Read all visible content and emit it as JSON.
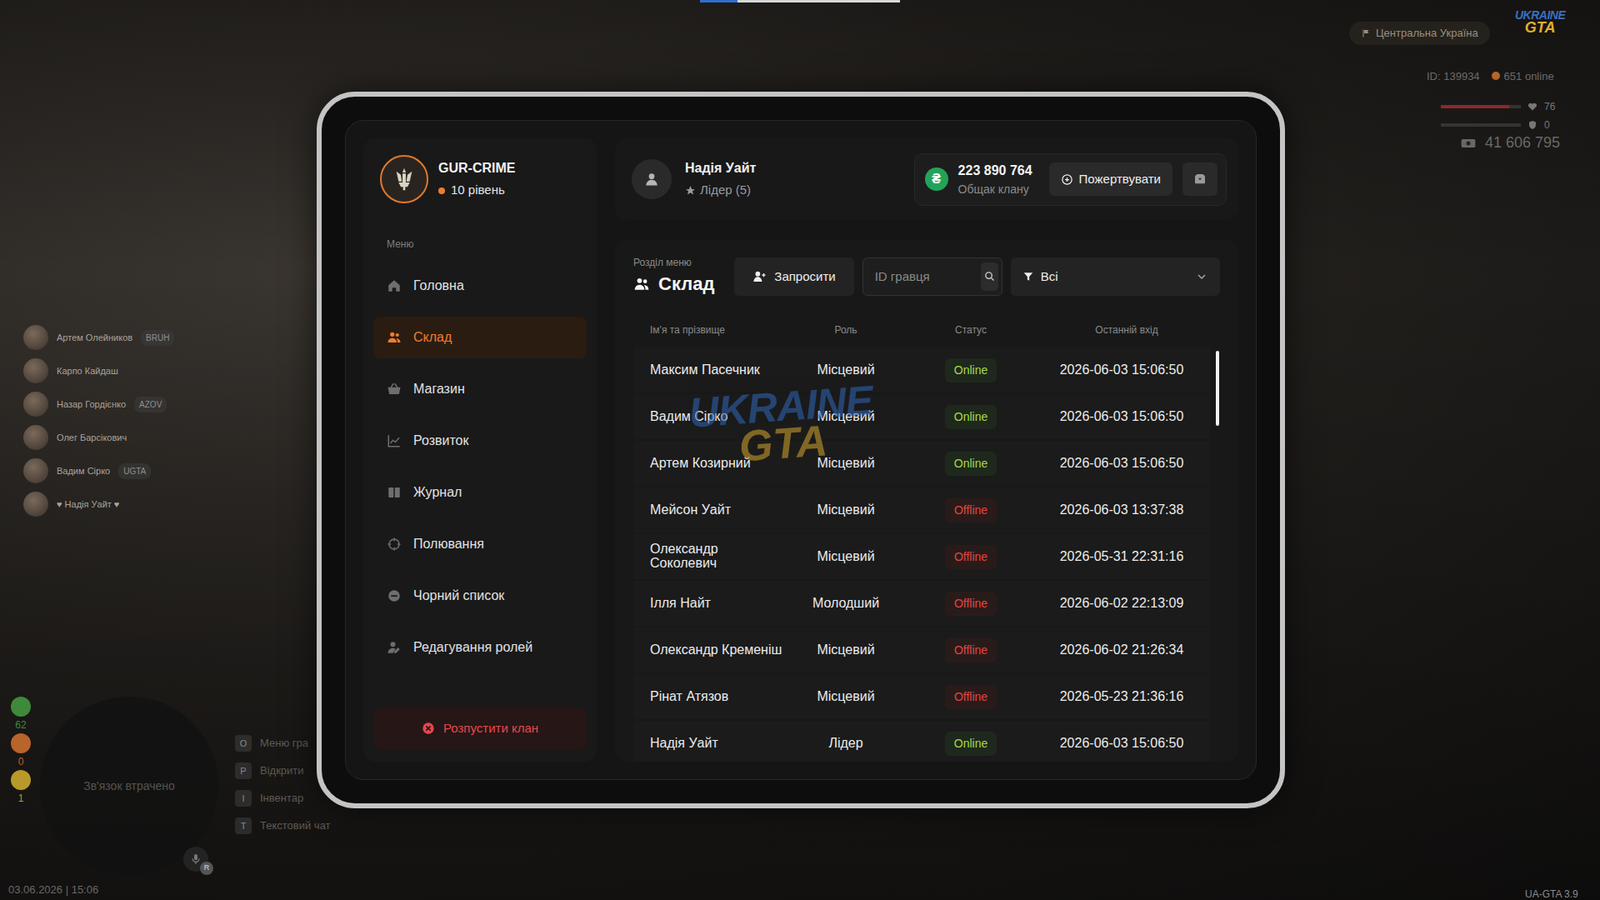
{
  "hud": {
    "region": "Центральна Україна",
    "logo": {
      "line1": "UKRAINE",
      "line2": "GTA"
    },
    "player_id": "ID: 139934",
    "online": "651 online",
    "health": {
      "value": "76",
      "level": 0.85
    },
    "armor": {
      "value": "0",
      "level": 0.0
    },
    "money": "41 606 795",
    "datetime": "03.06.2026 | 15:06",
    "version": "UA-GTA 3.9"
  },
  "players": [
    {
      "name": "Артем Олейников",
      "tag": "BRUH"
    },
    {
      "name": "Карпо Кайдаш",
      "tag": ""
    },
    {
      "name": "Назар Гордієнко",
      "tag": "AZOV"
    },
    {
      "name": "Олег Барсікович",
      "tag": ""
    },
    {
      "name": "Вадим Сірко",
      "tag": "UGTA"
    },
    {
      "name": "♥ Надія Уайт ♥",
      "tag": ""
    }
  ],
  "counters": [
    {
      "value": "62",
      "color": "#3f8a3a"
    },
    {
      "value": "0",
      "color": "#b8642a"
    },
    {
      "value": "1",
      "color": "#b89a2a"
    }
  ],
  "minimap": {
    "text": "Зв'язок втрачено",
    "mic_key": "R"
  },
  "hotkeys": [
    {
      "key": "O",
      "label": "Меню гра"
    },
    {
      "key": "P",
      "label": "Відкрити"
    },
    {
      "key": "I",
      "label": "Інвентар"
    },
    {
      "key": "T",
      "label": "Текстовий чат"
    }
  ],
  "clan": {
    "name": "GUR-CRIME",
    "level": "10 рівень"
  },
  "sidebar": {
    "caption": "Меню",
    "items": [
      {
        "label": "Головна",
        "icon": "home",
        "selected": false
      },
      {
        "label": "Склад",
        "icon": "people",
        "selected": true
      },
      {
        "label": "Магазин",
        "icon": "basket",
        "selected": false
      },
      {
        "label": "Розвиток",
        "icon": "chart",
        "selected": false
      },
      {
        "label": "Журнал",
        "icon": "book",
        "selected": false
      },
      {
        "label": "Полювання",
        "icon": "crosshair",
        "selected": false
      },
      {
        "label": "Чорний список",
        "icon": "minus",
        "selected": false
      },
      {
        "label": "Редагування ролей",
        "icon": "personedit",
        "selected": false
      }
    ],
    "disband": "Розпустити клан"
  },
  "user": {
    "name": "Надія Уайт",
    "role": "Лідер (5)"
  },
  "bank": {
    "currency_icon": "₴",
    "amount": "223 890 764",
    "label": "Общак клану",
    "donate": "Пожертвувати"
  },
  "section": {
    "caption": "Розділ меню",
    "title": "Склад",
    "invite": "Запросити",
    "search_placeholder": "ID гравця",
    "filter": "Всі"
  },
  "table": {
    "columns": [
      "Ім'я та прізвище",
      "Роль",
      "Статус",
      "Останній вхід"
    ],
    "rows": [
      {
        "name": "Максим Пасечник",
        "role": "Місцевий",
        "status": "Online",
        "online": true,
        "last": "2026-06-03 15:06:50"
      },
      {
        "name": "Вадим Сірко",
        "role": "Місцевий",
        "status": "Online",
        "online": true,
        "last": "2026-06-03 15:06:50"
      },
      {
        "name": "Артем Козирний",
        "role": "Місцевий",
        "status": "Online",
        "online": true,
        "last": "2026-06-03 15:06:50"
      },
      {
        "name": "Мейсон Уайт",
        "role": "Місцевий",
        "status": "Offline",
        "online": false,
        "last": "2026-06-03 13:37:38"
      },
      {
        "name": "Олександр Соколевич",
        "role": "Місцевий",
        "status": "Offline",
        "online": false,
        "last": "2026-05-31 22:31:16"
      },
      {
        "name": "Ілля Найт",
        "role": "Молодший",
        "status": "Offline",
        "online": false,
        "last": "2026-06-02 22:13:09"
      },
      {
        "name": "Олександр Кременіш",
        "role": "Місцевий",
        "status": "Offline",
        "online": false,
        "last": "2026-06-02 21:26:34"
      },
      {
        "name": "Рінат Атязов",
        "role": "Місцевий",
        "status": "Offline",
        "online": false,
        "last": "2026-05-23 21:36:16"
      },
      {
        "name": "Надія Уайт",
        "role": "Лідер",
        "status": "Online",
        "online": true,
        "last": "2026-06-03 15:06:50"
      }
    ]
  },
  "watermark": {
    "line1": "UKRAINE",
    "line2": "GTA"
  }
}
